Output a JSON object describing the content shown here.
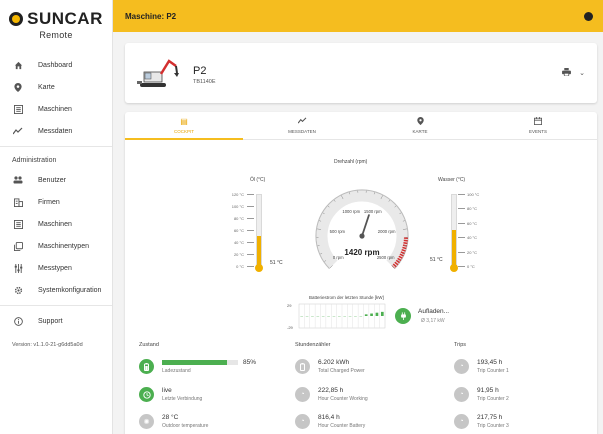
{
  "logo": {
    "brand": "SUNCAR",
    "sub": "Remote"
  },
  "nav": {
    "items": [
      {
        "label": "Dashboard",
        "icon": "home-icon"
      },
      {
        "label": "Karte",
        "icon": "map-pin-icon"
      },
      {
        "label": "Maschinen",
        "icon": "list-icon"
      },
      {
        "label": "Messdaten",
        "icon": "trend-icon"
      }
    ],
    "admin_section": "Administration",
    "admin_items": [
      {
        "label": "Benutzer",
        "icon": "users-icon"
      },
      {
        "label": "Firmen",
        "icon": "building-icon"
      },
      {
        "label": "Maschinen",
        "icon": "list-icon"
      },
      {
        "label": "Maschinentypen",
        "icon": "copy-icon"
      },
      {
        "label": "Messtypen",
        "icon": "sliders-icon"
      },
      {
        "label": "Systemkonfiguration",
        "icon": "gear-icon"
      }
    ],
    "support": "Support",
    "version": "Version: v1.1.0-21-g6dd5a0d"
  },
  "topbar": {
    "title": "Maschine: P2"
  },
  "machine": {
    "name": "P2",
    "model": "TB1140E"
  },
  "tabs": [
    {
      "label": "COCKPIT",
      "icon": "dashboard-icon",
      "active": true
    },
    {
      "label": "MESSDATEN",
      "icon": "trend-icon",
      "active": false
    },
    {
      "label": "KARTE",
      "icon": "map-pin-icon",
      "active": false
    },
    {
      "label": "EVENTS",
      "icon": "calendar-icon",
      "active": false
    }
  ],
  "cockpit": {
    "rpm_title": "Drehzahl (rpm)",
    "rpm": {
      "value": 1420,
      "value_text": "1420 rpm",
      "min": 0,
      "max": 2500,
      "labels": [
        "0 rpm",
        "500 rpm",
        "1000 rpm",
        "1500 rpm",
        "2000 rpm",
        "2500 rpm"
      ]
    },
    "oil": {
      "title": "Öl (°C)",
      "value": 51,
      "value_text": "51 °C",
      "min": 0,
      "max": 120,
      "ticks": [
        "120 °C",
        "100 °C",
        "80 °C",
        "60 °C",
        "40 °C",
        "20 °C",
        "0 °C"
      ]
    },
    "water": {
      "title": "Wasser (°C)",
      "value": 51,
      "value_text": "51 °C",
      "min": 0,
      "max": 100,
      "ticks": [
        "100 °C",
        "80 °C",
        "60 °C",
        "40 °C",
        "20 °C",
        "0 °C"
      ]
    },
    "battery_chart_title": "Batteriestrom der letzten Stunde [kW]",
    "battery_status": "Aufladen...",
    "battery_avg": "Ø 3,17 kW"
  },
  "chart_data": {
    "type": "bar",
    "title": "Batteriestrom der letzten Stunde [kW]",
    "ylim": [
      -29,
      29
    ],
    "y_tick_labels": [
      "29",
      "-29"
    ],
    "values": [
      0,
      0,
      0,
      0,
      0,
      0,
      0,
      0,
      0,
      0,
      0,
      0,
      4,
      6,
      8,
      10
    ],
    "grid": true
  },
  "zustand": {
    "title": "Zustand",
    "charge_percent": 85,
    "charge_text": "85%",
    "charge_label": "Ladezustand",
    "connection_value": "live",
    "connection_label": "Letzte Verbindung",
    "temp_value": "28 °C",
    "temp_label": "Outdoor temperature"
  },
  "stundenzaehler": {
    "title": "Stundenzähler",
    "items": [
      {
        "value": "6.202 kWh",
        "label": "Total Charged Power"
      },
      {
        "value": "222,85 h",
        "label": "Hour Counter Working"
      },
      {
        "value": "816,4 h",
        "label": "Hour Counter Battery"
      }
    ]
  },
  "trips": {
    "title": "Trips",
    "items": [
      {
        "value": "193,45 h",
        "label": "Trip Counter 1"
      },
      {
        "value": "91,95 h",
        "label": "Trip Counter 2"
      },
      {
        "value": "217,75 h",
        "label": "Trip Counter 3"
      }
    ]
  },
  "colors": {
    "accent": "#f5bd1f",
    "active_tab": "#e8a400",
    "green": "#4caf50",
    "gauge_fill": "#f0b000",
    "danger": "#d32f2f"
  }
}
